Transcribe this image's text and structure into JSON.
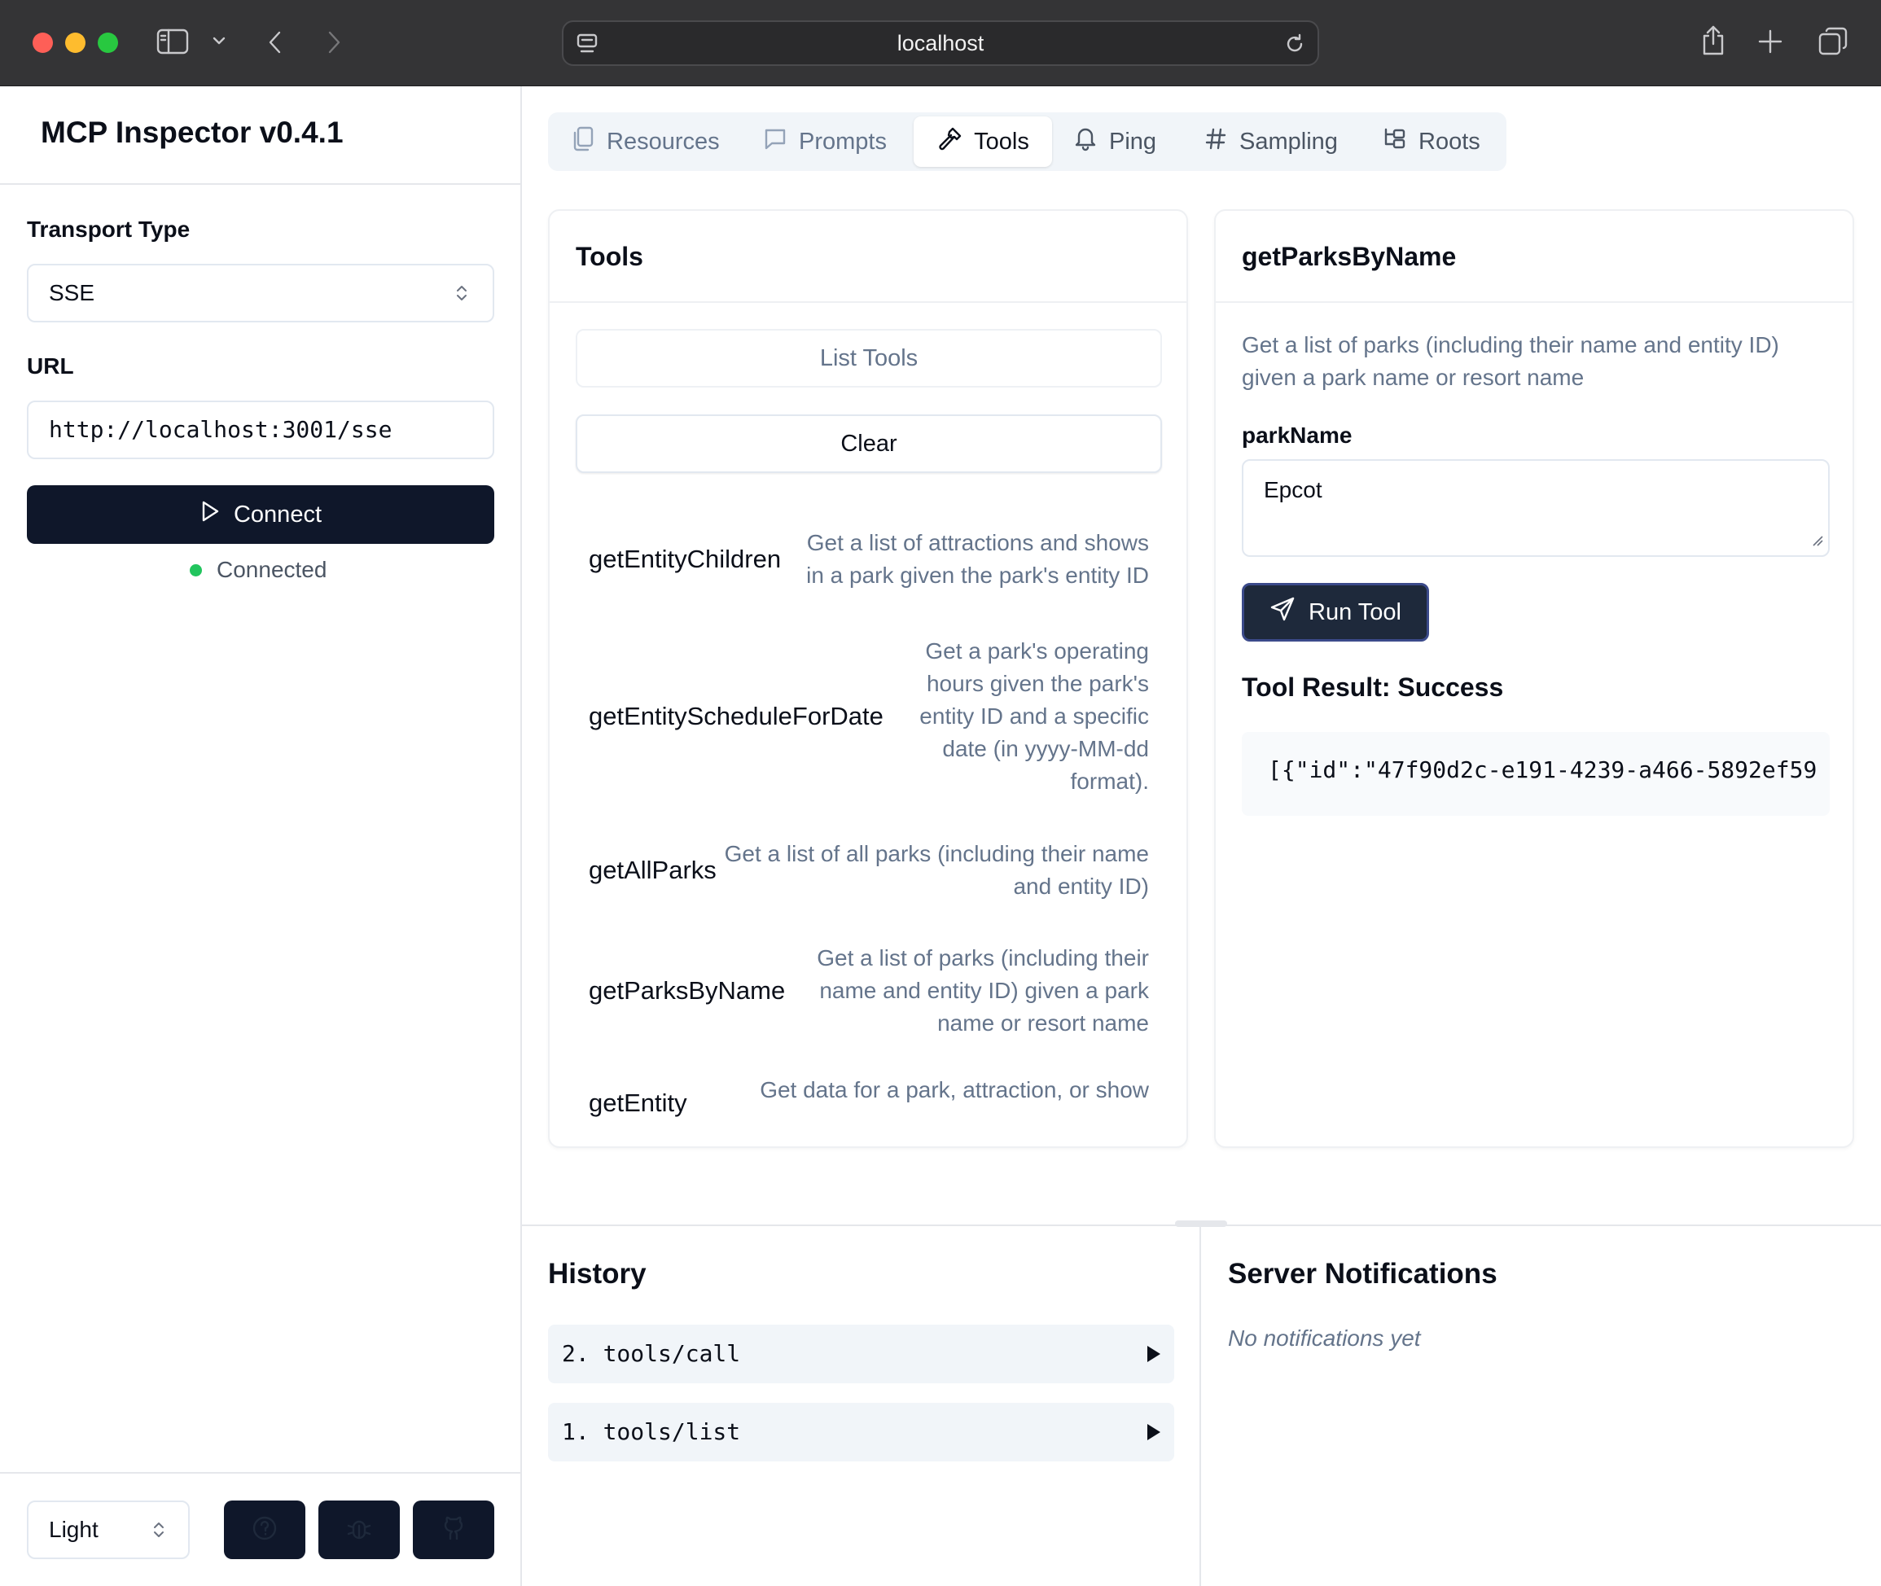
{
  "browser": {
    "address": "localhost"
  },
  "sidebar": {
    "title": "MCP Inspector v0.4.1",
    "transport_label": "Transport Type",
    "transport_value": "SSE",
    "url_label": "URL",
    "url_value": "http://localhost:3001/sse",
    "connect_label": "Connect",
    "status_text": "Connected",
    "theme_value": "Light"
  },
  "tabs": [
    {
      "label": "Resources",
      "icon": "files-icon"
    },
    {
      "label": "Prompts",
      "icon": "message-square-icon"
    },
    {
      "label": "Tools",
      "icon": "hammer-icon",
      "active": true
    },
    {
      "label": "Ping",
      "icon": "bell-icon"
    },
    {
      "label": "Sampling",
      "icon": "hash-icon"
    },
    {
      "label": "Roots",
      "icon": "folder-tree-icon"
    }
  ],
  "tools_panel": {
    "title": "Tools",
    "list_button": "List Tools",
    "clear_button": "Clear",
    "items": [
      {
        "name": "getEntityChildren",
        "description": "Get a list of attractions and shows in a park given the park's entity ID"
      },
      {
        "name": "getEntityScheduleForDate",
        "description": "Get a park's operating hours given the park's entity ID and a specific date (in yyyy-MM-dd format)."
      },
      {
        "name": "getAllParks",
        "description": "Get a list of all parks (including their name and entity ID)"
      },
      {
        "name": "getParksByName",
        "description": "Get a list of parks (including their name and entity ID) given a park name or resort name"
      },
      {
        "name": "getEntity",
        "description": "Get data for a park, attraction, or show"
      }
    ]
  },
  "detail_panel": {
    "title": "getParksByName",
    "description": "Get a list of parks (including their name and entity ID) given a park name or resort name",
    "param_label": "parkName",
    "param_value": "Epcot",
    "run_button": "Run Tool",
    "result_title": "Tool Result: Success",
    "result_text": "[{\"id\":\"47f90d2c-e191-4239-a466-5892ef59"
  },
  "history": {
    "title": "History",
    "items": [
      "2. tools/call",
      "1. tools/list"
    ]
  },
  "notifications": {
    "title": "Server Notifications",
    "empty_text": "No notifications yet"
  },
  "colors": {
    "primary": "#0f172a",
    "status_green": "#22c55e",
    "muted_text": "#64748b"
  }
}
